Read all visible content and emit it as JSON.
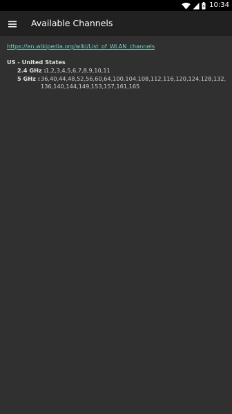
{
  "status_bar": {
    "time": "10:34",
    "icons": [
      "wifi-icon",
      "signal-icon",
      "battery-icon"
    ]
  },
  "app_bar": {
    "menu_icon": "menu-icon",
    "title": "Available Channels"
  },
  "content": {
    "link": "https://en.wikipedia.org/wiki/List_of_WLAN_channels",
    "region": {
      "title": "US - United States",
      "bands": [
        {
          "label": "2.4 GHz :",
          "channels": "1,2,3,4,5,6,7,8,9,10,11"
        },
        {
          "label": "5 GHz :",
          "channels": "36,40,44,48,52,56,60,64,100,104,108,112,116,120,124,128,132,136,140,144,149,153,157,161,165"
        }
      ]
    }
  },
  "colors": {
    "background": "#303030",
    "app_bar": "#212121",
    "status_bar": "#000000",
    "link": "#80cbc4",
    "text": "#e0e0e0"
  }
}
